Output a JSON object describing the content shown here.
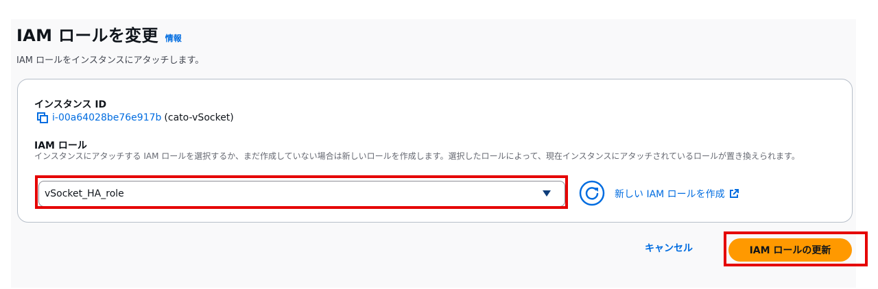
{
  "header": {
    "title": "IAM ロールを変更",
    "info_link": "情報",
    "description": "IAM ロールをインスタンスにアタッチします。"
  },
  "instance": {
    "label": "インスタンス ID",
    "id": "i-00a64028be76e917b",
    "name": "(cato-vSocket)",
    "copy_icon": "copy-icon"
  },
  "iam_role": {
    "label": "IAM ロール",
    "description": "インスタンスにアタッチする IAM ロールを選択するか、まだ作成していない場合は新しいロールを作成します。選択したロールによって、現在インスタンスにアタッチされているロールが置き換えられます。",
    "selected_value": "vSocket_HA_role",
    "caret_icon": "caret-down-icon",
    "refresh_icon": "refresh-icon",
    "create_link": "新しい IAM ロールを作成",
    "external_icon": "external-link-icon"
  },
  "actions": {
    "cancel_label": "キャンセル",
    "submit_label": "IAM ロールの更新"
  },
  "colors": {
    "link": "#006ce0",
    "primary": "#ff9900",
    "highlight": "#e50000"
  }
}
